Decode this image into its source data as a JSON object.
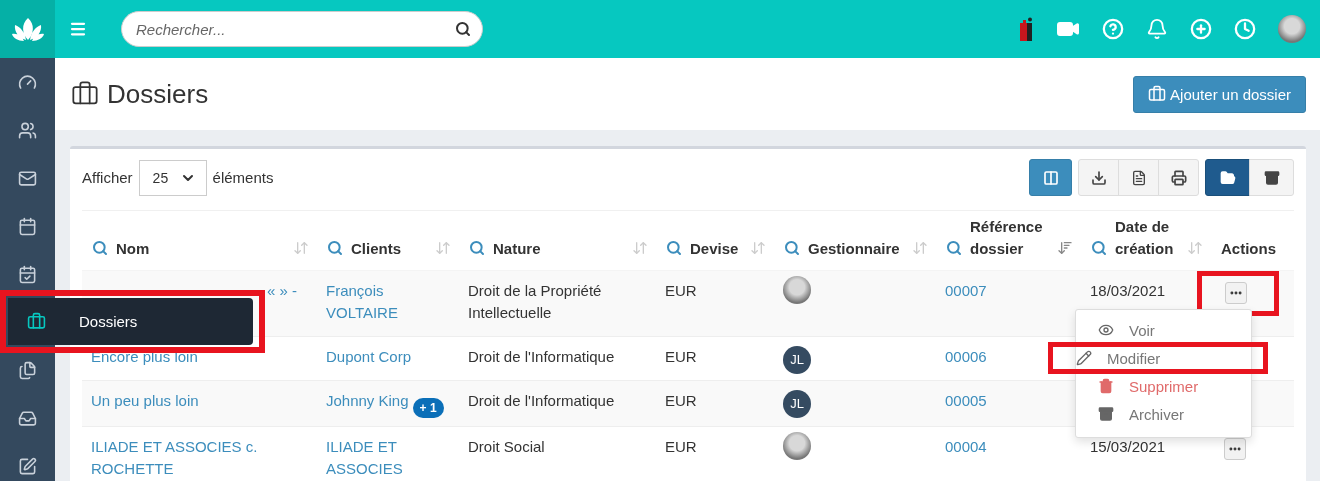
{
  "topbar": {
    "search": {
      "placeholder": "Rechercher..."
    }
  },
  "sidebar": {
    "items": [
      {
        "selected": false
      },
      {
        "selected": false
      },
      {
        "selected": false
      },
      {
        "selected": false
      },
      {
        "selected": false
      },
      {
        "selected": true,
        "flyout_label": "Dossiers",
        "highlighted": true
      },
      {
        "selected": false
      },
      {
        "selected": false
      },
      {
        "selected": false
      }
    ]
  },
  "page": {
    "title": "Dossiers",
    "add_button": "Ajouter un dossier"
  },
  "table_controls": {
    "show_label": "Afficher",
    "page_size": "25",
    "unit_label": "éléments",
    "view_toggle": [
      {
        "selected": true
      },
      {
        "selected": false
      }
    ]
  },
  "table": {
    "columns": [
      {
        "label": "Nom",
        "searchable": true,
        "sortable": true
      },
      {
        "label": "Clients",
        "searchable": true,
        "sortable": true
      },
      {
        "label": "Nature",
        "searchable": true,
        "sortable": true
      },
      {
        "label": "Devise",
        "searchable": true,
        "sortable": true
      },
      {
        "label": "Gestionnaire",
        "searchable": true,
        "sortable": true
      },
      {
        "label": "Référence dossier",
        "searchable": true,
        "sortable": true,
        "sort_active": true
      },
      {
        "label": "Date de création",
        "searchable": true,
        "sortable": true
      },
      {
        "label": "Actions",
        "searchable": false,
        "sortable": false
      }
    ],
    "rows": [
      {
        "name": "« » -",
        "client": "François VOLTAIRE",
        "nature": "Droit de la Propriété Intellectuelle",
        "currency": "EUR",
        "manager": {
          "kind": "photo"
        },
        "reference": "00007",
        "date": "18/03/2021",
        "actions_button": true,
        "actions_highlighted": true
      },
      {
        "name": "Encore plus loin",
        "client": "Dupont Corp",
        "nature": "Droit de l'Informatique",
        "currency": "EUR",
        "manager": {
          "kind": "initials",
          "initials": "JL"
        },
        "reference": "00006",
        "actions_button": false,
        "actions_highlighted": false
      },
      {
        "name": "Un peu plus loin",
        "client": "Johnny King",
        "client_badge": "+ 1",
        "nature": "Droit de l'Informatique",
        "currency": "EUR",
        "manager": {
          "kind": "initials",
          "initials": "JL"
        },
        "reference": "00005",
        "actions_button": false,
        "actions_highlighted": false
      },
      {
        "name": "ILIADE ET ASSOCIES c. ROCHETTE",
        "client": "ILIADE ET ASSOCIES",
        "nature": "Droit Social",
        "currency": "EUR",
        "manager": {
          "kind": "photo"
        },
        "reference": "00004",
        "date": "15/03/2021",
        "actions_button": true,
        "actions_highlighted": false
      }
    ]
  },
  "action_menu": {
    "items": [
      {
        "label": "Voir",
        "kind": "normal",
        "highlighted": false
      },
      {
        "label": "Modifier",
        "kind": "normal",
        "highlighted": true
      },
      {
        "label": "Supprimer",
        "kind": "danger",
        "highlighted": false
      },
      {
        "label": "Archiver",
        "kind": "normal",
        "highlighted": false
      }
    ]
  }
}
